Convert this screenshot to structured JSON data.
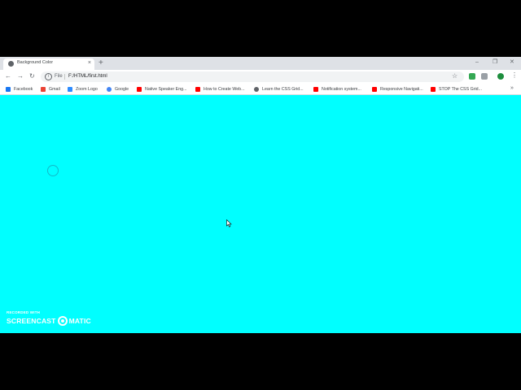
{
  "browser": {
    "tab": {
      "title": "Background Color",
      "close": "×"
    },
    "new_tab": "+",
    "window_controls": {
      "minimize": "–",
      "restore": "❐",
      "close": "✕"
    },
    "nav": {
      "back": "←",
      "forward": "→",
      "reload": "↻"
    },
    "omnibox": {
      "info": "i",
      "scheme": "File",
      "url": "F:/HTML/first.html"
    },
    "bookmark_star": "☆",
    "menu": "⋮",
    "bookmarks": [
      {
        "label": "Facebook",
        "icon": "facebook-icon",
        "color": "#1877f2"
      },
      {
        "label": "Gmail",
        "icon": "gmail-icon",
        "color": "#ea4335"
      },
      {
        "label": "Zoom Logo",
        "icon": "zoom-icon",
        "color": "#2d8cff"
      },
      {
        "label": "Google",
        "icon": "google-icon",
        "color": "#4285f4"
      },
      {
        "label": "Native Speaker Eng...",
        "icon": "youtube-icon",
        "color": "#ff0000"
      },
      {
        "label": "How to Create Web...",
        "icon": "youtube-icon",
        "color": "#ff0000"
      },
      {
        "label": "Learn the CSS Grid...",
        "icon": "globe-icon",
        "color": "#5f6368"
      },
      {
        "label": "Notification system...",
        "icon": "youtube-icon",
        "color": "#ff0000"
      },
      {
        "label": "Responsive Navigati...",
        "icon": "youtube-icon",
        "color": "#ff0000"
      },
      {
        "label": "STOP The CSS Grid...",
        "icon": "youtube-icon",
        "color": "#ff0000"
      }
    ],
    "bookmarks_more": "»"
  },
  "page": {
    "background": "#00ffff"
  },
  "watermark": {
    "recorded": "RECORDED WITH",
    "brand_left": "SCREENCAST",
    "brand_right": "MATIC"
  },
  "colors": {
    "ext_green": "#34a853",
    "ext_gray": "#9aa0a6",
    "ext_green2": "#1e8e3e"
  }
}
